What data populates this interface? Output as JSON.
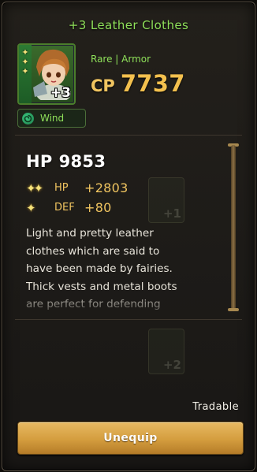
{
  "item": {
    "title": "+3 Leather Clothes",
    "rarity": "Rare | Armor",
    "cp_label": "CP",
    "cp_value": "7737",
    "upgrade_badge": "+3",
    "rarity_stars": 3,
    "element": "Wind",
    "main_stat": {
      "label": "HP",
      "value": "9853"
    },
    "sub_stats": [
      {
        "stars": "✦✦",
        "name": "HP",
        "value": "+2803"
      },
      {
        "stars": "✦",
        "name": "DEF",
        "value": "+80"
      }
    ],
    "description_lines": [
      "Light and pretty leather",
      "clothes which are said to",
      "have been made by fairies.",
      "Thick vests and metal boots",
      "are perfect for defending"
    ]
  },
  "footer": {
    "tradable": "Tradable",
    "unequip_label": "Unequip"
  },
  "colors": {
    "title_green": "#8fe05a",
    "gold": "#f0c460",
    "button_gold": "#d49d3e"
  },
  "icons": {
    "element": "wind-icon",
    "rarity": "star-icon"
  }
}
